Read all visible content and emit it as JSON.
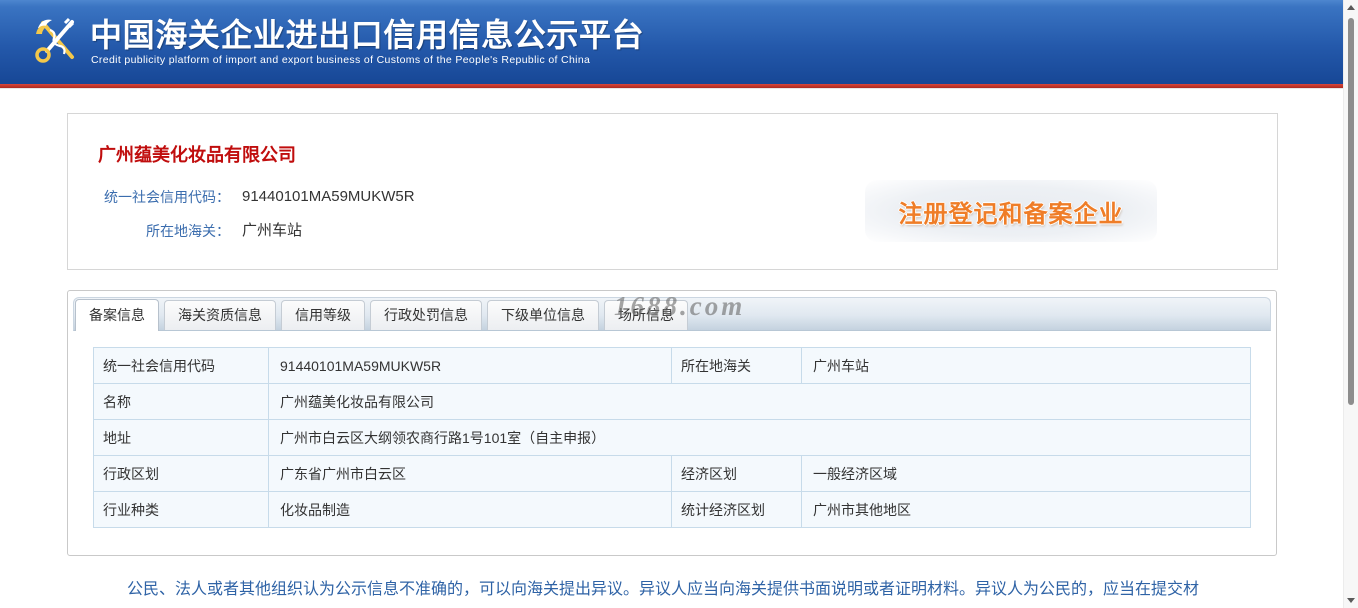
{
  "header": {
    "title": "中国海关企业进出口信用信息公示平台",
    "subtitle": "Credit publicity platform of import and export business of Customs of the People's Republic of China"
  },
  "company": {
    "name": "广州蕴美化妆品有限公司",
    "credit_code_label": "统一社会信用代码：",
    "credit_code": "91440101MA59MUKW5R",
    "customs_label": "所在地海关：",
    "customs": "广州车站",
    "badge": "注册登记和备案企业"
  },
  "tabs": [
    {
      "label": "备案信息",
      "active": true
    },
    {
      "label": "海关资质信息",
      "active": false
    },
    {
      "label": "信用等级",
      "active": false
    },
    {
      "label": "行政处罚信息",
      "active": false
    },
    {
      "label": "下级单位信息",
      "active": false
    },
    {
      "label": "场所信息",
      "active": false
    }
  ],
  "watermark": "1688.com",
  "record_table": {
    "rows": [
      {
        "label": "统一社会信用代码",
        "value": "91440101MA59MUKW5R",
        "label2": "所在地海关",
        "value2": "广州车站"
      },
      {
        "label": "名称",
        "value": "广州蕴美化妆品有限公司"
      },
      {
        "label": "地址",
        "value": "广州市白云区大纲领农商行路1号101室（自主申报）"
      },
      {
        "label": "行政区划",
        "value": "广东省广州市白云区",
        "label2": "经济区划",
        "value2": "一般经济区域"
      },
      {
        "label": "行业种类",
        "value": "化妆品制造",
        "label2": "统计经济区划",
        "value2": "广州市其他地区"
      }
    ]
  },
  "notice": "公民、法人或者其他组织认为公示信息不准确的，可以向海关提出异议。异议人应当向海关提供书面说明或者证明材料。异议人为公民的，应当在提交材",
  "icons": {
    "emblem": "customs-emblem-icon",
    "scroll_up": "scroll-up-arrow-icon",
    "scroll_down": "scroll-down-arrow-icon"
  },
  "colors": {
    "header_blue": "#2459ab",
    "header_line": "#c4372c",
    "company_name": "#c00d0d",
    "label_blue": "#3b6dae",
    "badge_orange": "#ef7d27",
    "notice_blue": "#2f63a6",
    "cell_bg": "#f4f9fd",
    "cell_border": "#c7dbea"
  }
}
